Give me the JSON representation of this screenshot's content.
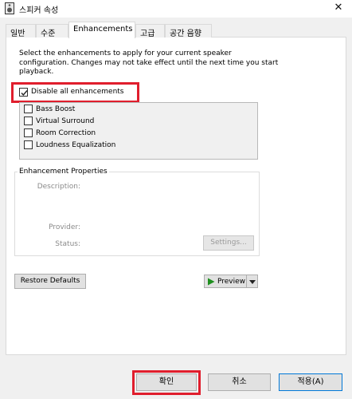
{
  "window": {
    "title": "스피커 속성",
    "close_glyph": "✕"
  },
  "tabs": [
    {
      "label": "일반"
    },
    {
      "label": "수준"
    },
    {
      "label": "Enhancements"
    },
    {
      "label": "고급"
    },
    {
      "label": "공간 음향"
    }
  ],
  "active_tab": "Enhancements",
  "enhancements": {
    "description": "Select the enhancements to apply for your current speaker configuration. Changes may not take effect until the next time you start playback.",
    "disable_all": {
      "label": "Disable all enhancements",
      "checked": true
    },
    "items": [
      {
        "label": "Bass Boost",
        "checked": false
      },
      {
        "label": "Virtual Surround",
        "checked": false
      },
      {
        "label": "Room Correction",
        "checked": false
      },
      {
        "label": "Loudness Equalization",
        "checked": false
      }
    ]
  },
  "properties": {
    "group_title": "Enhancement Properties",
    "description_label": "Description:",
    "provider_label": "Provider:",
    "status_label": "Status:",
    "settings_button": "Settings..."
  },
  "actions": {
    "restore_defaults": "Restore Defaults",
    "preview": "Preview"
  },
  "footer": {
    "ok": "확인",
    "cancel": "취소",
    "apply": "적용(A)"
  },
  "colors": {
    "highlight": "#e01e2d",
    "preview_play": "#1f8f1f",
    "apply_border": "#0078d7"
  },
  "icons": {
    "window": "speaker-icon",
    "preview": "play-icon",
    "dropdown": "chevron-down-icon",
    "check": "checkmark-icon"
  }
}
